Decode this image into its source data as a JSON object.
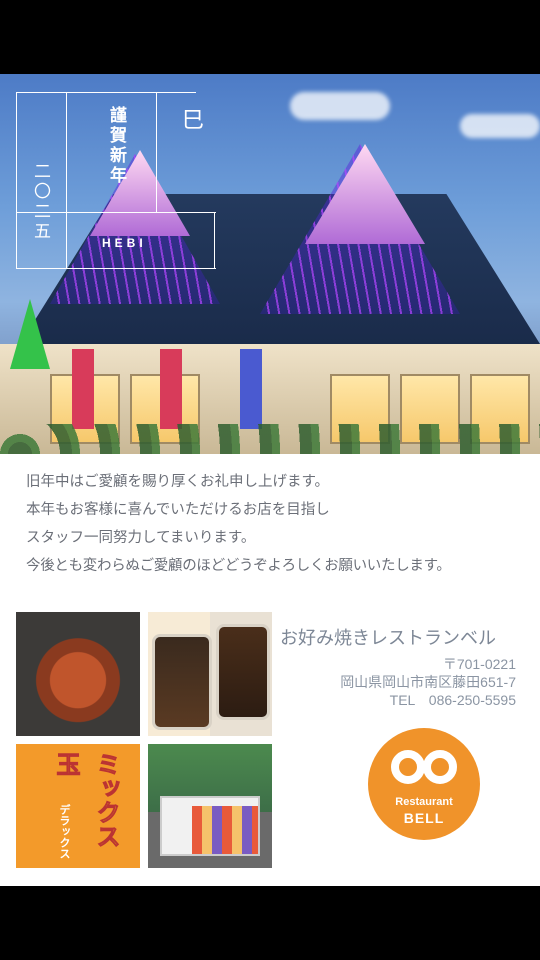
{
  "greeting": {
    "kinga": "謹賀新年",
    "year": "二〇二五",
    "zodiac": "巳",
    "zodiac_romaji": "HEBI"
  },
  "message": {
    "lines": [
      "旧年中はご愛顧を賜り厚くお礼申し上げます。",
      "本年もお客様に喜んでいただけるお店を目指し",
      "スタッフ一同努力してまいります。",
      "今後とも変わらぬご愛顧のほどどうぞよろしくお願いいたします。"
    ]
  },
  "store": {
    "name": "お好み焼きレストランベル",
    "postal": "〒701-0221",
    "address": "岡山県岡山市南区藤田651-7",
    "tel": "TEL　086-250-5595"
  },
  "logo": {
    "line1": "Restaurant",
    "line2": "BELL"
  },
  "photos": {
    "poster_title": "ミックス玉",
    "poster_sub": "デラックス"
  },
  "colors": {
    "accent_orange": "#f0932a",
    "text_gray": "#6b6f78",
    "store_name_gray": "#7d8796"
  }
}
